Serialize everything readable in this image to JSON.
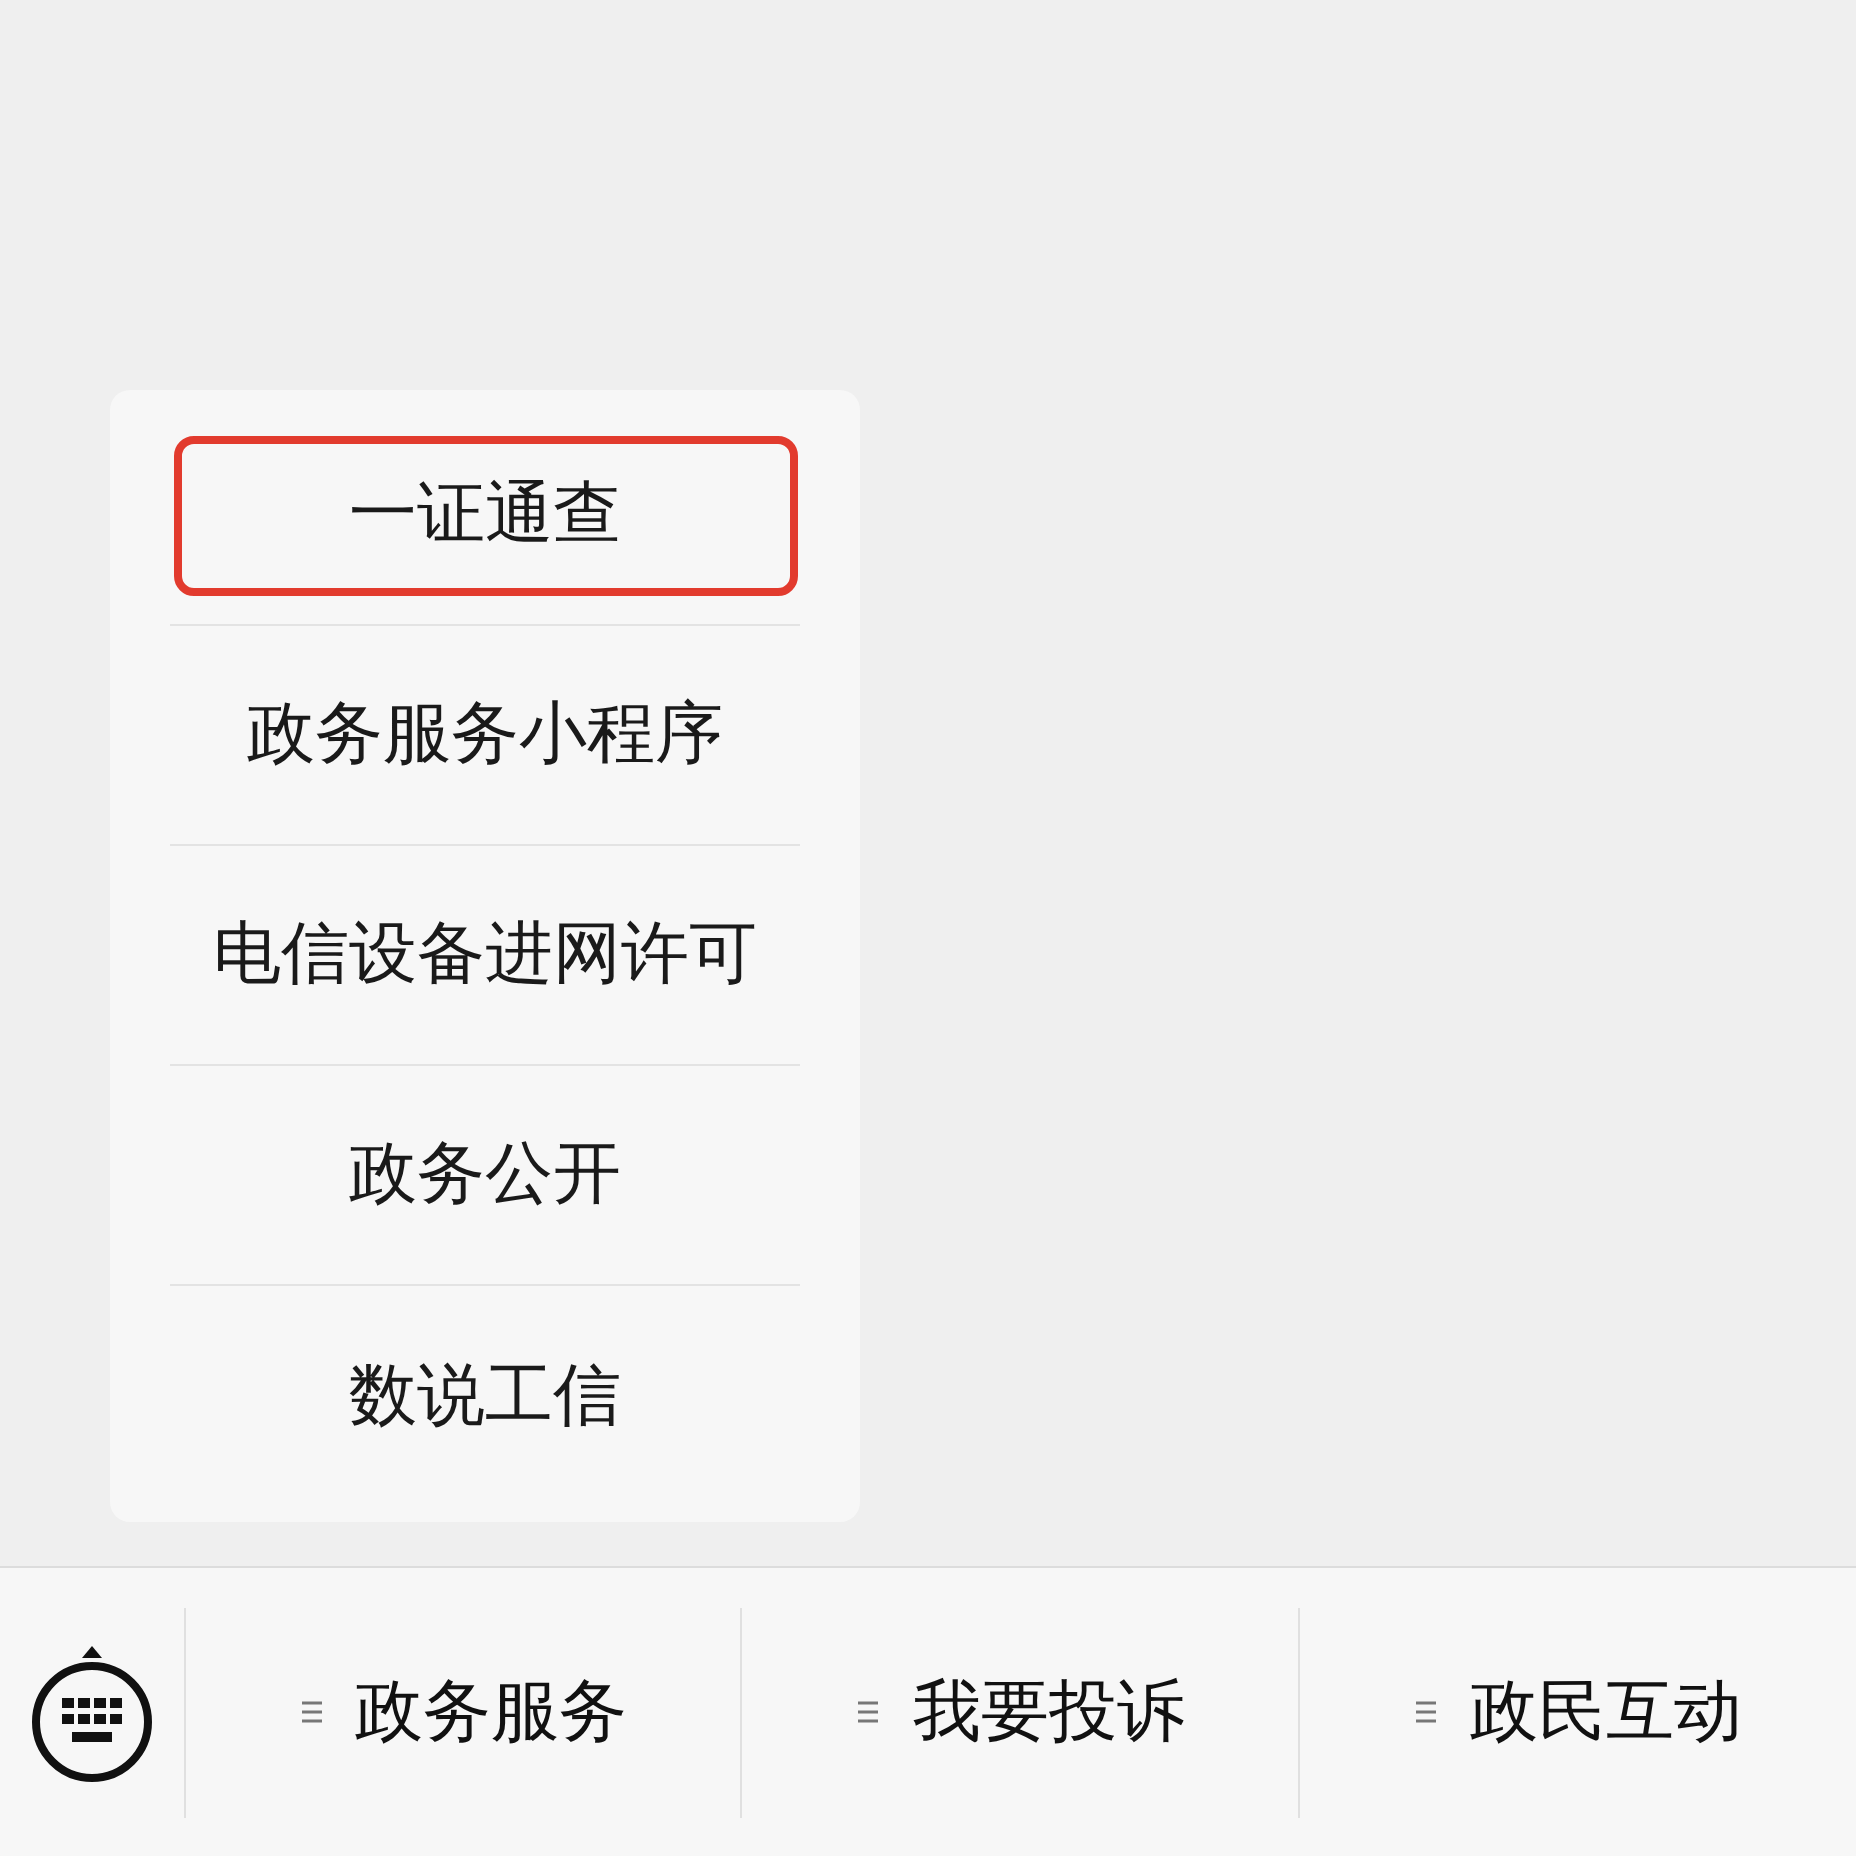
{
  "popup_menu": {
    "items": [
      {
        "label": "一证通查",
        "highlighted": true
      },
      {
        "label": "政务服务小程序",
        "highlighted": false
      },
      {
        "label": "电信设备进网许可",
        "highlighted": false
      },
      {
        "label": "政务公开",
        "highlighted": false
      },
      {
        "label": "数说工信",
        "highlighted": false
      }
    ]
  },
  "menu_bar": {
    "items": [
      {
        "label": "政务服务"
      },
      {
        "label": "我要投诉"
      },
      {
        "label": "政民互动"
      }
    ]
  }
}
